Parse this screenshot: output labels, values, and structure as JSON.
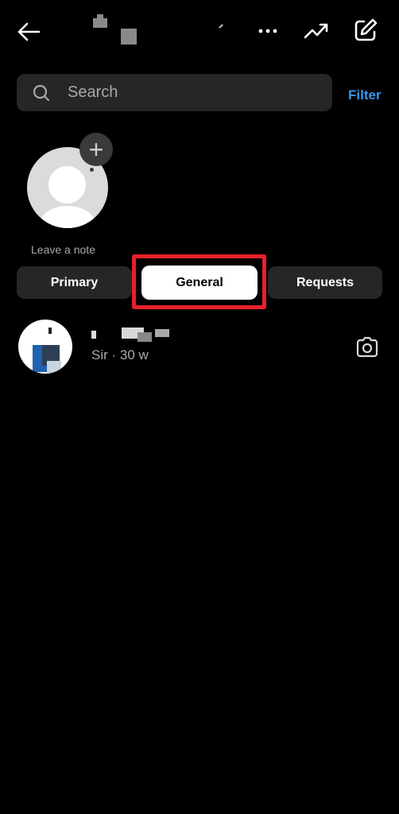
{
  "header": {
    "title_redacted": true,
    "back_icon": "arrow-left-icon",
    "more_icon": "more-horizontal-icon",
    "insights_icon": "trending-up-icon",
    "compose_icon": "edit-square-icon"
  },
  "search": {
    "placeholder": "Search",
    "value": "",
    "icon": "search-icon"
  },
  "filter_label": "Filter",
  "note": {
    "plus": "+",
    "label": "Leave a note"
  },
  "tabs": [
    {
      "label": "Primary",
      "selected": false
    },
    {
      "label": "General",
      "selected": true
    },
    {
      "label": "Requests",
      "selected": false
    }
  ],
  "highlight_color": "#e8202a",
  "accent_color": "#3797f0",
  "threads": [
    {
      "name_redacted": true,
      "subtitle": "Sir · 30 w",
      "action_icon": "camera-icon"
    }
  ]
}
